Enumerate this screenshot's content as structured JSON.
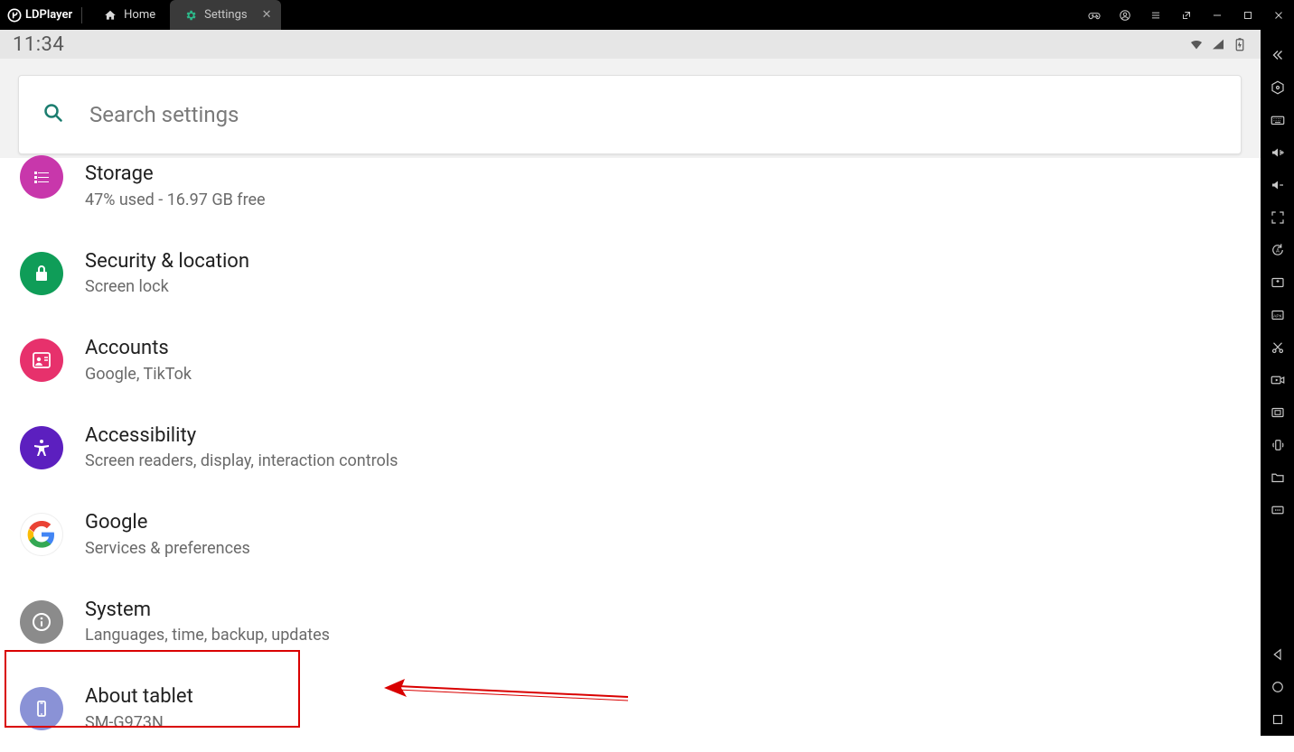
{
  "app": {
    "name": "LDPlayer"
  },
  "tabs": {
    "home": {
      "label": "Home"
    },
    "settings": {
      "label": "Settings"
    }
  },
  "status": {
    "time": "11:34"
  },
  "search": {
    "placeholder": "Search settings"
  },
  "settings_items": [
    {
      "id": "storage",
      "title": "Storage",
      "subtitle": "47% used - 16.97 GB free",
      "icon_bg": "#c837ab"
    },
    {
      "id": "security",
      "title": "Security & location",
      "subtitle": "Screen lock",
      "icon_bg": "#0f9d58"
    },
    {
      "id": "accounts",
      "title": "Accounts",
      "subtitle": "Google, TikTok",
      "icon_bg": "#e7316c"
    },
    {
      "id": "accessibility",
      "title": "Accessibility",
      "subtitle": "Screen readers, display, interaction controls",
      "icon_bg": "#5c1fbf"
    },
    {
      "id": "google",
      "title": "Google",
      "subtitle": "Services & preferences",
      "icon_bg": "#ffffff"
    },
    {
      "id": "system",
      "title": "System",
      "subtitle": "Languages, time, backup, updates",
      "icon_bg": "#8b8b8b"
    },
    {
      "id": "about",
      "title": "About tablet",
      "subtitle": "SM-G973N",
      "icon_bg": "#8a92d6"
    }
  ],
  "annotations": {
    "highlight_target": "about"
  }
}
